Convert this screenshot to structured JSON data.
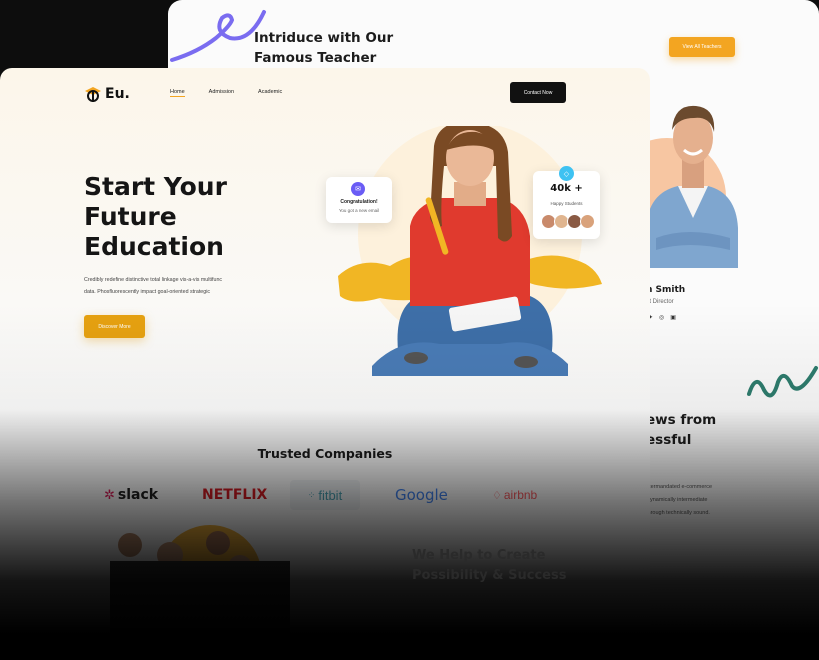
{
  "back": {
    "title_line1": "Intriduce with Our",
    "title_line2": "Famous Teacher",
    "view_button": "View All Teachers",
    "teacher_name": "n Smith",
    "teacher_role": "nt Director",
    "section_line1": "ews from",
    "section_line2": "essful",
    "para_line1": "ntermandated e-commerce",
    "para_line2": "Dynamically intermediate",
    "para_line3": "through technically sound."
  },
  "front": {
    "logo_text": "Eu.",
    "nav": [
      "Home",
      "Admission",
      "Academic"
    ],
    "contact_button": "Contact Now",
    "hero_title_1": "Start Your",
    "hero_title_2": "Future",
    "hero_title_3": "Education",
    "hero_desc_1": "Credibly redefine distinctive total linkage vis-a-vis multifunc",
    "hero_desc_2": "data. Phosfluorescently impact goal-oriented strategic",
    "discover_button": "Discover More",
    "congrats_title": "Congratulation!",
    "congrats_sub": "You got a new email",
    "students_count": "40k +",
    "students_label": "Happy Students",
    "trusted_title": "Trusted Companies",
    "companies": [
      "slack",
      "NETFLIX",
      "fitbit",
      "Google",
      "airbnb"
    ],
    "bottom_line1": "We Help to Create",
    "bottom_line2": "Possibility & Success"
  },
  "colors": {
    "accent": "#f3a521",
    "dark": "#111111",
    "teacher_bg": "#f7c6a2",
    "teal": "#2e7d6e",
    "purple": "#7a6cf0"
  }
}
